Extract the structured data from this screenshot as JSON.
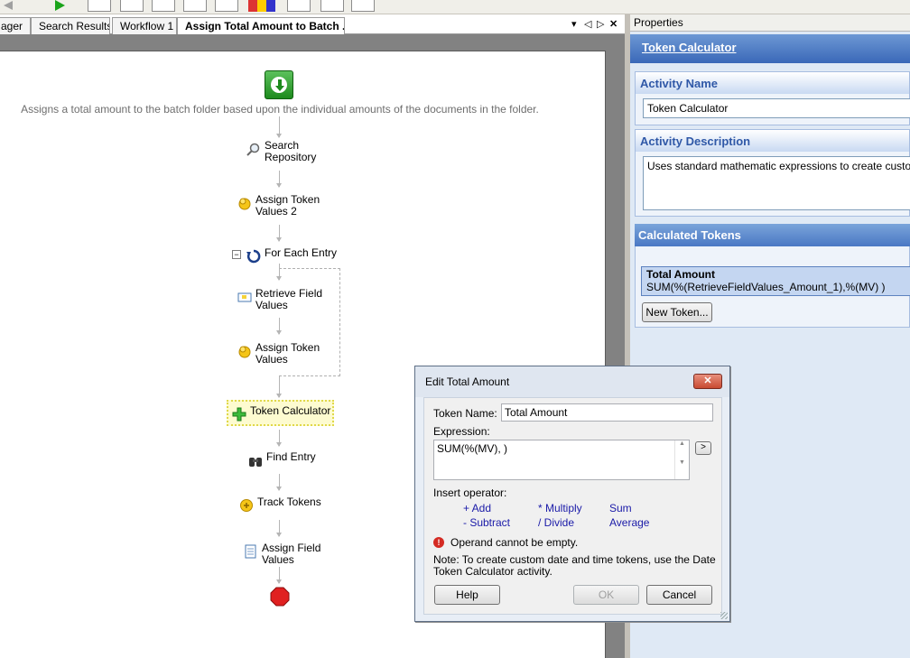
{
  "tabs": [
    {
      "label": "ager"
    },
    {
      "label": "Search Results"
    },
    {
      "label": "Workflow 1"
    },
    {
      "label": "Assign Total Amount to Batch ..."
    }
  ],
  "tab_controls": {
    "menu": "▾",
    "prev": "◁",
    "next": "▷",
    "close": "✕"
  },
  "workflow": {
    "description": "Assigns a total amount to the batch folder based upon the individual amounts of the documents in the folder.",
    "nodes": [
      {
        "label_1": "Search",
        "label_2": "Repository",
        "icon": "magnifier-icon"
      },
      {
        "label_1": "Assign Token",
        "label_2": "Values 2",
        "icon": "token-coin-icon"
      },
      {
        "label_1": "For Each Entry",
        "icon": "loop-icon"
      },
      {
        "label_1": "Retrieve Field",
        "label_2": "Values",
        "icon": "field-card-icon"
      },
      {
        "label_1": "Assign Token",
        "label_2": "Values",
        "icon": "token-coin-icon"
      },
      {
        "label_1": "Token Calculator",
        "icon": "plus-icon"
      },
      {
        "label_1": "Find Entry",
        "icon": "binoculars-icon"
      },
      {
        "label_1": "Track Tokens",
        "icon": "track-token-icon"
      },
      {
        "label_1": "Assign Field",
        "label_2": "Values",
        "icon": "document-icon"
      }
    ],
    "collapse_symbol": "−"
  },
  "properties": {
    "header": "Properties",
    "banner": "Token Calculator",
    "activity_name_title": "Activity Name",
    "activity_name_value": "Token Calculator",
    "activity_description_title": "Activity Description",
    "activity_description_value": "Uses standard mathematic expressions to create custom tokens",
    "calculated_tokens_title": "Calculated Tokens",
    "token": {
      "name": "Total Amount",
      "expression": "SUM(%(RetrieveFieldValues_Amount_1),%(MV) )"
    },
    "new_token_button": "New Token..."
  },
  "dialog": {
    "title": "Edit Total Amount",
    "close": "✕",
    "token_name_label": "Token Name:",
    "token_name_value": "Total Amount",
    "expression_label": "Expression:",
    "expression_value": "SUM(%(MV), )",
    "expand_button": ">",
    "insert_operator_label": "Insert operator:",
    "operators": {
      "add": "+ Add",
      "multiply": "* Multiply",
      "sum": "Sum",
      "subtract": "- Subtract",
      "divide": "/ Divide",
      "average": "Average"
    },
    "error_message": "Operand cannot be empty.",
    "note_line_1": "Note: To create custom date and time tokens, use the Date",
    "note_line_2": "Token Calculator activity.",
    "help_button": "Help",
    "ok_button": "OK",
    "cancel_button": "Cancel"
  },
  "colors": {
    "accent": "#3a68b8",
    "group_title": "#2f58a7",
    "operator_link": "#1a1aa8",
    "error": "#d42a22"
  }
}
